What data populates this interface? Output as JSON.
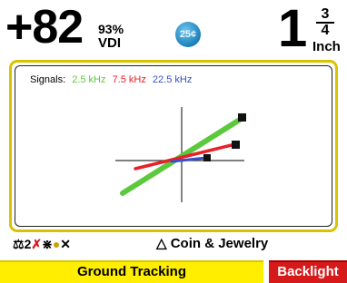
{
  "vdi": {
    "value": "+82",
    "percent": "93%",
    "label": "VDI"
  },
  "target_icon": {
    "text": "25¢",
    "icon": "coin-25-cent-icon",
    "color": "#1a7fb8"
  },
  "depth": {
    "whole": "1",
    "numerator": "3",
    "denominator": "4",
    "unit": "Inch"
  },
  "signals": {
    "label": "Signals:",
    "frequencies": [
      {
        "name": "2.5 kHz",
        "color": "#5cc83c"
      },
      {
        "name": "7.5 kHz",
        "color": "#e8202a"
      },
      {
        "name": "22.5 kHz",
        "color": "#3a4ec8"
      }
    ]
  },
  "status": {
    "icons": [
      "ground-balance-icon",
      "2",
      "disabled-audio-icon",
      "pinpoint-icon",
      "accessory-icon"
    ],
    "count_text": "2",
    "mode_icon": "triangle-outline-icon",
    "mode_label": "Coin & Jewelry"
  },
  "softkeys": {
    "left_label": "Ground Tracking",
    "right_label": "Backlight"
  },
  "colors": {
    "panel_border": "#d9c300",
    "softkey_left_bg": "#ffee00",
    "softkey_right_bg": "#d61a1a"
  }
}
